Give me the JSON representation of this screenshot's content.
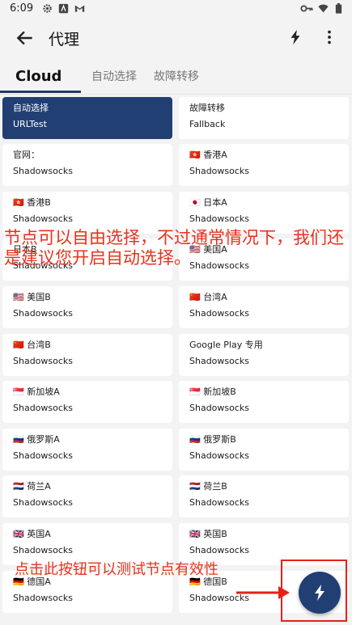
{
  "status_bar": {
    "time": "6:09"
  },
  "app_bar": {
    "title": "代理"
  },
  "tabs": [
    {
      "label": "Cloud"
    },
    {
      "label": "自动选择"
    },
    {
      "label": "故障转移"
    }
  ],
  "proxies": [
    {
      "name": "自动选择",
      "type": "URLTest",
      "selected": true
    },
    {
      "name": "故障转移",
      "type": "Fallback"
    },
    {
      "name": "官网：",
      "type": "Shadowsocks"
    },
    {
      "name": "🇭🇰 香港A",
      "type": "Shadowsocks"
    },
    {
      "name": "🇭🇰 香港B",
      "type": "Shadowsocks"
    },
    {
      "name": "🇯🇵 日本A",
      "type": "Shadowsocks"
    },
    {
      "name": "日本B",
      "type": "Shadowsocks"
    },
    {
      "name": "🇺🇸 美国A",
      "type": "Shadowsocks"
    },
    {
      "name": "🇺🇸 美国B",
      "type": "Shadowsocks"
    },
    {
      "name": "🇨🇳 台湾A",
      "type": "Shadowsocks"
    },
    {
      "name": "🇨🇳 台湾B",
      "type": "Shadowsocks"
    },
    {
      "name": "Google Play 专用",
      "type": "Shadowsocks"
    },
    {
      "name": "🇸🇬 新加坡A",
      "type": "Shadowsocks"
    },
    {
      "name": "🇸🇬 新加坡B",
      "type": "Shadowsocks"
    },
    {
      "name": "🇷🇺 俄罗斯A",
      "type": "Shadowsocks"
    },
    {
      "name": "🇷🇺 俄罗斯B",
      "type": "Shadowsocks"
    },
    {
      "name": "🇳🇱 荷兰A",
      "type": "Shadowsocks"
    },
    {
      "name": "🇳🇱 荷兰B",
      "type": "Shadowsocks"
    },
    {
      "name": "🇬🇧 英国A",
      "type": "Shadowsocks"
    },
    {
      "name": "🇬🇧 英国B",
      "type": "Shadowsocks"
    },
    {
      "name": "🇩🇪 德国A",
      "type": "Shadowsocks"
    },
    {
      "name": "🇩🇪 德国B",
      "type": "Shadowsocks"
    }
  ],
  "annotations": {
    "line1": "节点可以自由选择，不过通常情况下，我们还",
    "line2": "是建议您开启自动选择。",
    "fab_hint": "点击此按钮可以测试节点有效性"
  },
  "colors": {
    "accent": "#223f73",
    "annotation": "#e8321c"
  }
}
